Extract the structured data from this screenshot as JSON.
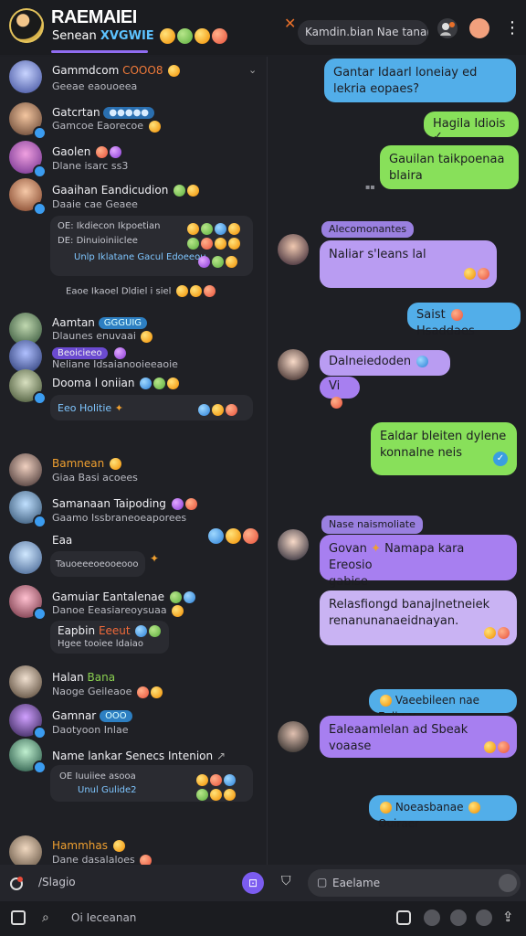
{
  "header": {
    "title": "RAEMAIEI",
    "subtitle": "Senean",
    "subtitle_highlight": "XVGWIE",
    "search_label": "Kamdin.bian Nae tanan",
    "close_icon": "x-icon"
  },
  "conversations": [
    {
      "name": "Gammdcom",
      "name_tag": "COOO8",
      "preview": "Geeae eaouoeea",
      "time": ""
    },
    {
      "name": "Gatcrtan",
      "name_tag": "",
      "preview": "Gamcoe Eaorecoe",
      "time": ""
    },
    {
      "name": "Gaolen",
      "name_tag": "",
      "preview": "Dlane isarc ss3",
      "time": ""
    },
    {
      "name": "Gaaihan Eandicudion",
      "name_tag": "",
      "preview": "Daaie cae Geaee",
      "time": ""
    }
  ],
  "thread_panel_1": {
    "lines": [
      "OE: Ikdiecon Ikpoetian",
      "DE: Dinuioiniiclee",
      "Unlp Iklatane Gacul Edoeeou"
    ],
    "footer": "Eaoe Ikaoel Dldiel i siel"
  },
  "conversations_2": [
    {
      "name": "Aamtan",
      "name_tag": "GGGUIG",
      "preview": "Dlaunes enuvaai"
    },
    {
      "name": "",
      "name_tag": "Beoicieeo",
      "preview": "Neliane Idsaianooieeaoie"
    },
    {
      "name": "Dooma l oniian",
      "name_tag": "",
      "preview": "Eeo Holitie"
    }
  ],
  "conversations_3": [
    {
      "name": "Bamnean",
      "preview": "Giaa Basi acoees"
    },
    {
      "name": "Samanaan Taipoding",
      "preview": "Gaamo Issbraneoeaporees"
    },
    {
      "name": "Eaa",
      "preview": "Tauoeeeoeooeooo"
    },
    {
      "name": "Gamuiar Eantalenae",
      "preview": "Danoe Eeasiareoysuaa"
    },
    {
      "name": "Eapbin",
      "name_tag": "Eeeut",
      "preview": "Hgee tooiee ldaiao"
    },
    {
      "name": "Halan",
      "name_tag": "Bana",
      "preview": "Naoge Geileaoe"
    },
    {
      "name": "Gamnar",
      "name_tag": "OOO",
      "preview": "Daotyoon Inlae"
    },
    {
      "name": "Name lankar Senecs Intenion",
      "preview": "",
      "panel_lines": [
        "OE Iuuiiee asooa",
        "Unul Gulide2"
      ]
    },
    {
      "name": "Hammhas",
      "preview": "Dane dasalaloes"
    }
  ],
  "messages": [
    {
      "side": "out",
      "color": "blue",
      "text": "Gantar Idaarl loneiay ed lekria eopaes?"
    },
    {
      "side": "out",
      "color": "green",
      "text": "Hagila Idiois"
    },
    {
      "side": "out",
      "color": "green",
      "text": "Gauilan taikpoenaa blaira"
    },
    {
      "side": "in",
      "sender": "Alecomonantes",
      "color": "purple",
      "text": "Naliar s'leans lal"
    },
    {
      "side": "out",
      "color": "blue",
      "text": "Saist",
      "text2": "Hsaddaes"
    },
    {
      "side": "in",
      "color": "purple",
      "text": "Dalneiedoden",
      "text2": "Vi"
    },
    {
      "side": "out",
      "color": "green",
      "text": "Ealdar bleiten dylene konnalne neis"
    },
    {
      "side": "in",
      "sender": "Nase naismoliate",
      "color": "purple",
      "text": "Govan",
      "text2": "Namapa kara Ereosio",
      "text3": "gabise"
    },
    {
      "side": "in",
      "color": "lavender",
      "text": "Relasfiongd banajlnetneiek renanunanaeidnayan."
    },
    {
      "side": "out",
      "color": "blue",
      "text": "Vaeebileen nae Ealiv"
    },
    {
      "side": "in",
      "color": "purple",
      "text": "Ealeaamlelan ad Sbeak voaase"
    },
    {
      "side": "out",
      "color": "blue",
      "text": "Noeasbanae",
      "text2": "Ouiraer"
    }
  ],
  "composer": {
    "left_label": "Slagio",
    "input_placeholder": "Eaelame"
  },
  "bottom": {
    "label": "Oi Ieceanan"
  },
  "colors": {
    "accent": "#8f6cf0",
    "blue": "#52aee9",
    "green": "#88e05a",
    "purple": "#b99cf2"
  }
}
